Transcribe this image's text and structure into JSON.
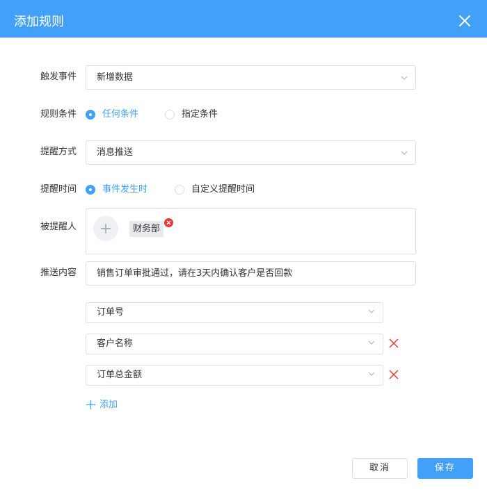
{
  "dialog": {
    "title": "添加规则",
    "close_icon": "close-icon"
  },
  "trigger_event": {
    "label": "触发事件",
    "value": "新增数据"
  },
  "rule_condition": {
    "label": "规则条件",
    "options": [
      "任何条件",
      "指定条件"
    ],
    "selected": "任何条件"
  },
  "reminder_method": {
    "label": "提醒方式",
    "value": "消息推送"
  },
  "reminder_time": {
    "label": "提醒时间",
    "options": [
      "事件发生时",
      "自定义提醒时间"
    ],
    "selected": "事件发生时"
  },
  "recipients": {
    "label": "被提醒人",
    "add_icon": "plus-icon",
    "tags": [
      "财务部"
    ]
  },
  "push_content": {
    "label": "推送内容",
    "value": "销售订单审批通过，请在3天内确认客户是否回款"
  },
  "fields": [
    {
      "value": "订单号",
      "removable": false
    },
    {
      "value": "客户名称",
      "removable": true
    },
    {
      "value": "订单总金额",
      "removable": true
    }
  ],
  "add_field_label": "添加",
  "footer": {
    "cancel_label": "取消",
    "save_label": "保存"
  },
  "colors": {
    "primary": "#42a0f8",
    "danger": "#e53935",
    "border": "#dcdfe6"
  }
}
